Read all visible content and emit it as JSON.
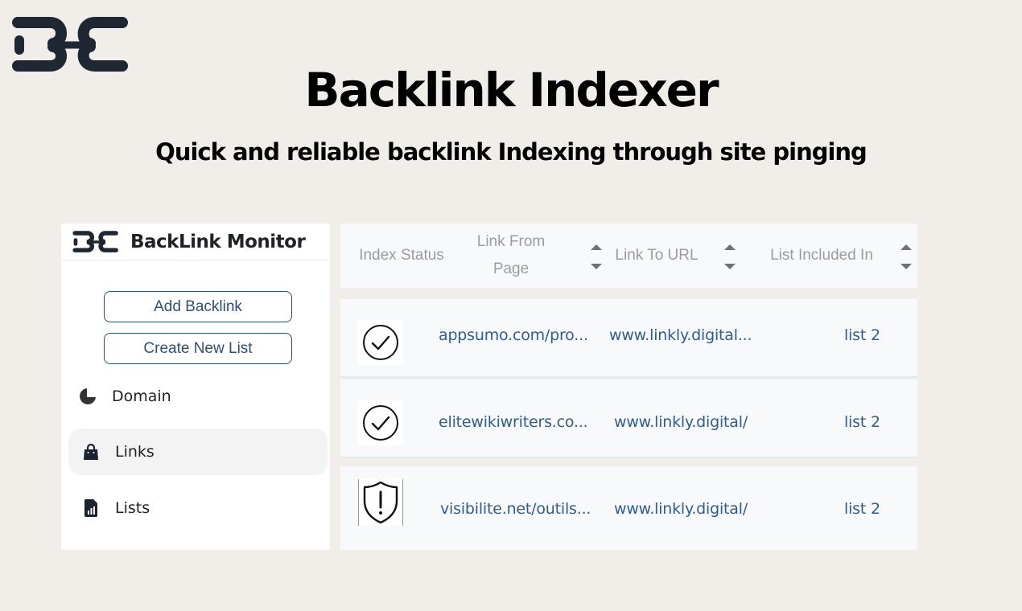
{
  "hero": {
    "title": "Backlink Indexer",
    "subtitle": "Quick and reliable backlink Indexing through site pinging",
    "logo_icon": "chain-link-logo-icon"
  },
  "sidebar": {
    "app_title": "BackLink Monitor",
    "buttons": {
      "add_backlink": "Add Backlink",
      "create_new_list": "Create New List"
    },
    "nav": [
      {
        "label": "Domain",
        "icon": "pie-chart-icon",
        "active": false
      },
      {
        "label": "Links",
        "icon": "shopping-bag-icon",
        "active": true
      },
      {
        "label": "Lists",
        "icon": "document-chart-icon",
        "active": false
      }
    ]
  },
  "table": {
    "columns": [
      {
        "label": "Index Status",
        "sortable": false
      },
      {
        "label": "Link From Page",
        "sortable": true
      },
      {
        "label": "Link To URL",
        "sortable": true
      },
      {
        "label": "List Included In",
        "sortable": true
      }
    ],
    "rows": [
      {
        "status": "indexed",
        "status_icon": "check-circle-icon",
        "from": "appsumo.com/pro...",
        "to": "www.linkly.digital...",
        "list": "list 2"
      },
      {
        "status": "indexed",
        "status_icon": "check-circle-icon",
        "from": "elitewikiwriters.co...",
        "to": "www.linkly.digital/",
        "list": "list 2"
      },
      {
        "status": "warning",
        "status_icon": "shield-alert-icon",
        "from": "visibilite.net/outils...",
        "to": "www.linkly.digital/",
        "list": "list 2"
      }
    ]
  },
  "colors": {
    "background": "#f1eeea",
    "link_text": "#2f5d8f",
    "header_text": "#9a9ca2",
    "dark": "#1f2733"
  }
}
